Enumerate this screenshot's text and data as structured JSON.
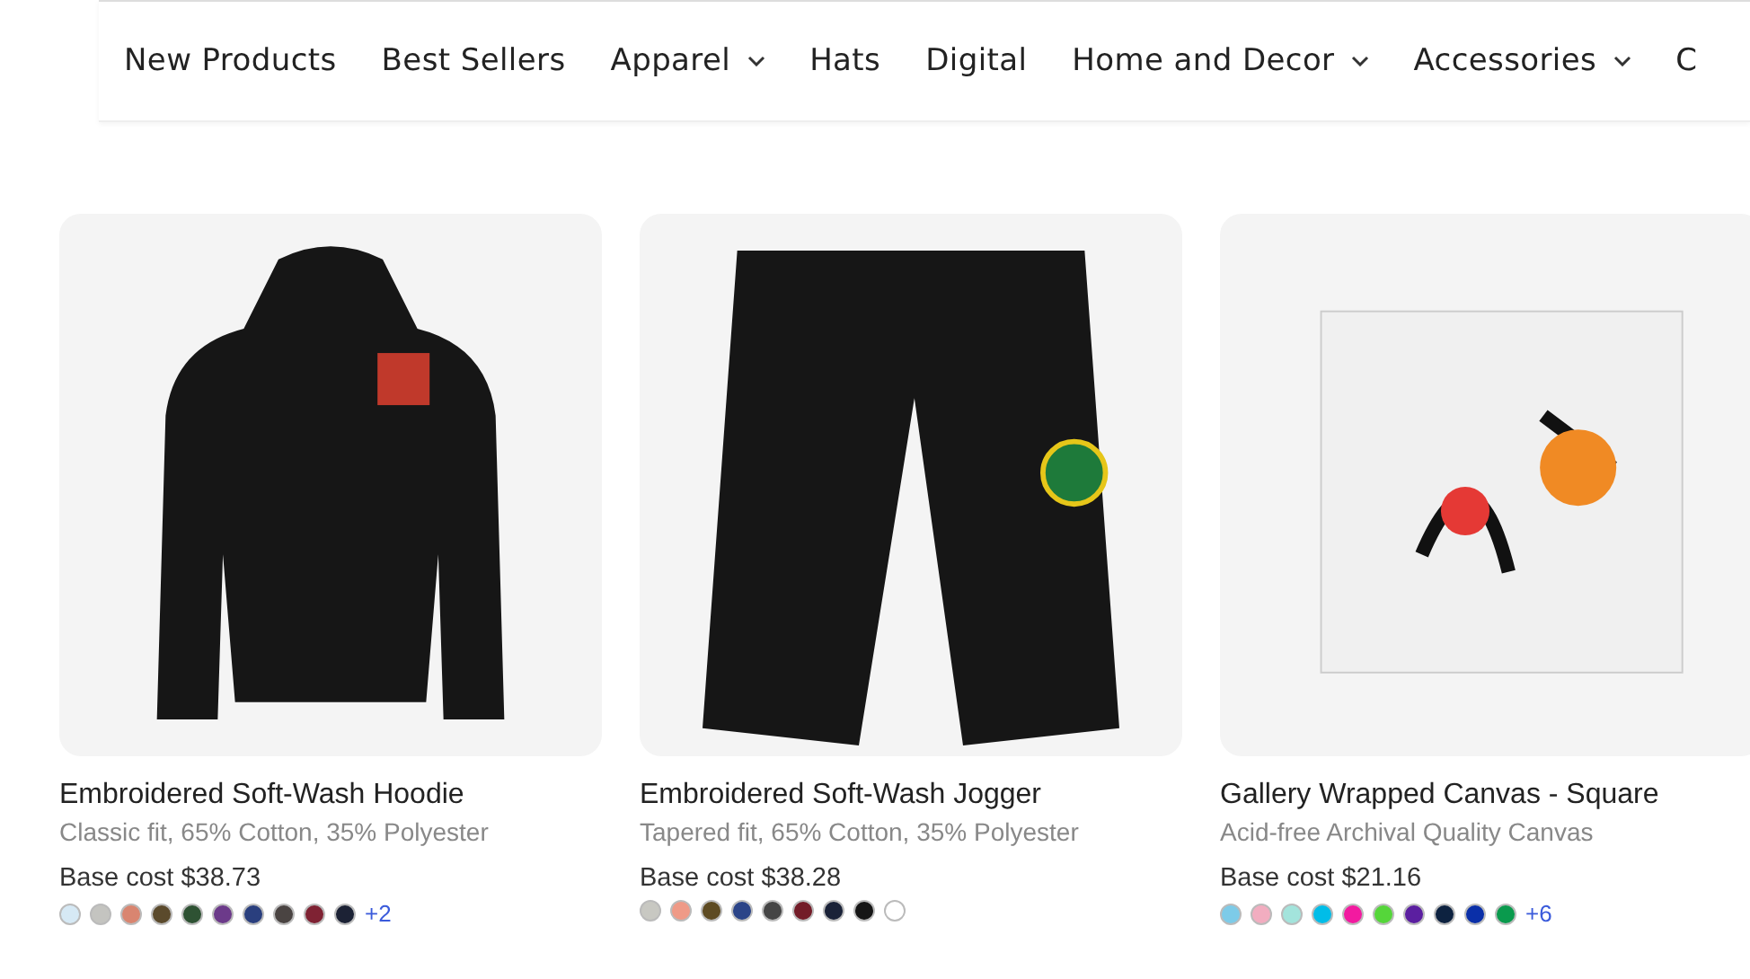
{
  "nav": {
    "items": [
      {
        "label": "New Products",
        "dropdown": false
      },
      {
        "label": "Best Sellers",
        "dropdown": false
      },
      {
        "label": "Apparel",
        "dropdown": true
      },
      {
        "label": "Hats",
        "dropdown": false
      },
      {
        "label": "Digital",
        "dropdown": false
      },
      {
        "label": "Home and Decor",
        "dropdown": true
      },
      {
        "label": "Accessories",
        "dropdown": true
      },
      {
        "label": "C",
        "dropdown": false
      }
    ]
  },
  "products": [
    {
      "kind": "hoodie",
      "title": "Embroidered Soft-Wash Hoodie",
      "subtitle": "Classic fit, 65% Cotton, 35% Polyester",
      "price": "Base cost $38.73",
      "colors": [
        {
          "color": "#d6e9f5"
        },
        {
          "color": "#c4c4c0"
        },
        {
          "color": "#d98570"
        },
        {
          "color": "#5b4a2c"
        },
        {
          "color": "#2e5233"
        },
        {
          "color": "#6c3a8a"
        },
        {
          "color": "#2a3f7e"
        },
        {
          "color": "#4a4442"
        },
        {
          "color": "#7f2233"
        },
        {
          "color": "#1c2235"
        }
      ],
      "more": "+2"
    },
    {
      "kind": "jogger",
      "title": "Embroidered Soft-Wash Jogger",
      "subtitle": "Tapered fit, 65% Cotton, 35% Polyester",
      "price": "Base cost $38.28",
      "colors": [
        {
          "color": "#c8c8c2"
        },
        {
          "color": "#ef9a87"
        },
        {
          "color": "#5e4b22"
        },
        {
          "color": "#2b4488"
        },
        {
          "color": "#454545"
        },
        {
          "color": "#731c28"
        },
        {
          "color": "#1a2238"
        },
        {
          "color": "#161616"
        },
        {
          "color": "#ffffff"
        }
      ]
    },
    {
      "kind": "canvas",
      "title": "Gallery Wrapped Canvas - Square",
      "subtitle": "Acid-free Archival Quality Canvas",
      "price": "Base cost $21.16",
      "colors": [
        {
          "color": "#7dcbe8"
        },
        {
          "color": "#f2adc0"
        },
        {
          "color": "#a3e4dc"
        },
        {
          "color": "#00bde8"
        },
        {
          "color": "#f21aa0"
        },
        {
          "color": "#55d63a"
        },
        {
          "color": "#5b1fa0"
        },
        {
          "color": "#0d2240"
        },
        {
          "color": "#0a2fa8"
        },
        {
          "color": "#0a9a4d"
        }
      ],
      "more": "+6"
    }
  ]
}
